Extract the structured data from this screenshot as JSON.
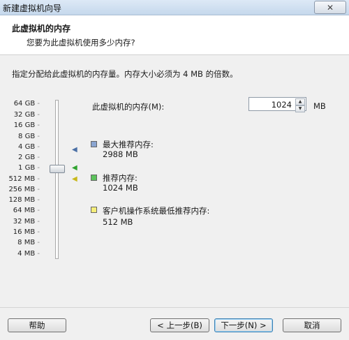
{
  "window": {
    "title": "新建虚拟机向导",
    "close_glyph": "✕"
  },
  "header": {
    "title": "此虚拟机的内存",
    "subtitle": "您要为此虚拟机使用多少内存?"
  },
  "instruction": "指定分配给此虚拟机的内存量。内存大小必须为 4 MB 的倍数。",
  "memory": {
    "label": "此虚拟机的内存(M):",
    "value": "1024",
    "unit": "MB"
  },
  "scale": [
    "64 GB",
    "32 GB",
    "16 GB",
    "8 GB",
    "4 GB",
    "2 GB",
    "1 GB",
    "512 MB",
    "256 MB",
    "128 MB",
    "64 MB",
    "32 MB",
    "16 MB",
    "8 MB",
    "4 MB"
  ],
  "legend": {
    "max": {
      "title": "最大推荐内存:",
      "value": "2988 MB",
      "color": "#8aa5d1"
    },
    "recommended": {
      "title": "推荐内存:",
      "value": "1024 MB",
      "color": "#5cc35c"
    },
    "min": {
      "title": "客户机操作系统最低推荐内存:",
      "value": "512 MB",
      "color": "#f5ee7a"
    }
  },
  "buttons": {
    "help": "帮助",
    "back": "< 上一步(B)",
    "next": "下一步(N) >",
    "cancel": "取消"
  }
}
